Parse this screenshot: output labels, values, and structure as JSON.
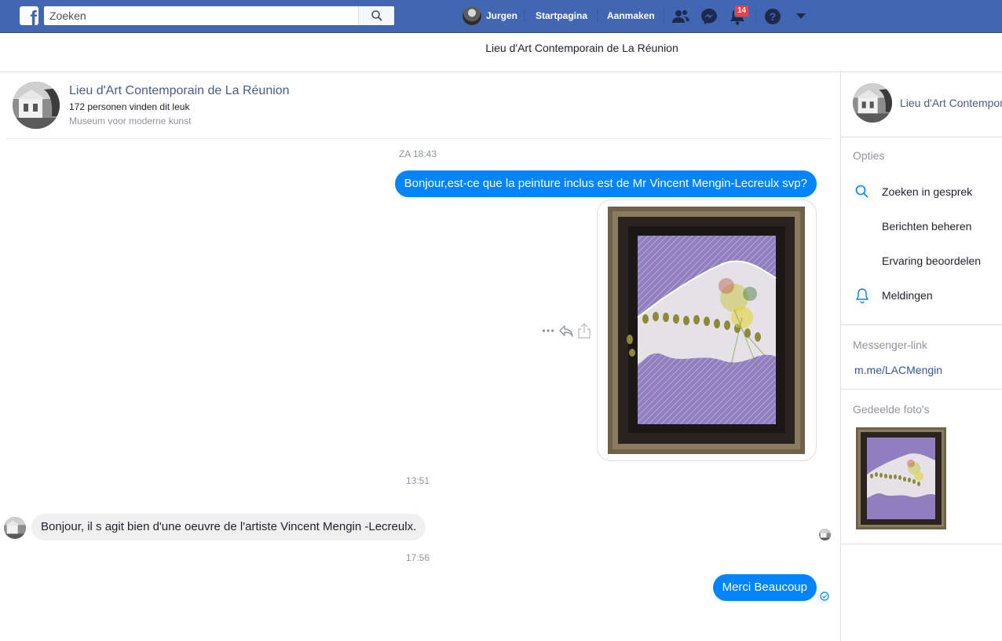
{
  "topbar": {
    "search_placeholder": "Zoeken",
    "user_name": "Jurgen",
    "home_label": "Startpagina",
    "create_label": "Aanmaken",
    "notifications_count": "14",
    "icons": [
      "facebook-logo",
      "search-icon",
      "friends-icon",
      "messenger-icon",
      "bell-icon",
      "help-icon",
      "caret-down-icon"
    ],
    "brand_color": "#4267b2"
  },
  "subheader": {
    "title": "Lieu d'Art Contemporain de La Réunion"
  },
  "conversation": {
    "page_name": "Lieu d'Art Contemporain de La Réunion",
    "likes": "172 personen vinden dit leuk",
    "category": "Museum voor moderne kunst",
    "messages": [
      {
        "timestamp": "ZA 18:43"
      },
      {
        "direction": "out",
        "text": "Bonjour,est-ce que la peinture inclus est de Mr Vincent Mengin-Lecreulx svp?"
      },
      {
        "direction": "out",
        "type": "photo"
      },
      {
        "timestamp": "13:51"
      },
      {
        "direction": "in",
        "text": "Bonjour, il s agit bien d'une oeuvre de l'artiste Vincent Mengin -Lecreulx."
      },
      {
        "timestamp": "17:56"
      },
      {
        "direction": "out",
        "text": "Merci Beaucoup"
      }
    ],
    "bubble_out_color": "#0084ff",
    "bubble_in_color": "#f1f0f0"
  },
  "sidebar": {
    "page_name": "Lieu d'Art Contemporain de La Réunion",
    "options_heading": "Opties",
    "items": [
      {
        "label": "Zoeken in gesprek",
        "icon": "search-icon"
      },
      {
        "label": "Berichten beheren",
        "icon": ""
      },
      {
        "label": "Ervaring beoordelen",
        "icon": ""
      },
      {
        "label": "Meldingen",
        "icon": "bell-icon"
      }
    ],
    "messenger_link_heading": "Messenger-link",
    "messenger_link": "m.me/LACMengin",
    "shared_photos_heading": "Gedeelde foto's"
  }
}
